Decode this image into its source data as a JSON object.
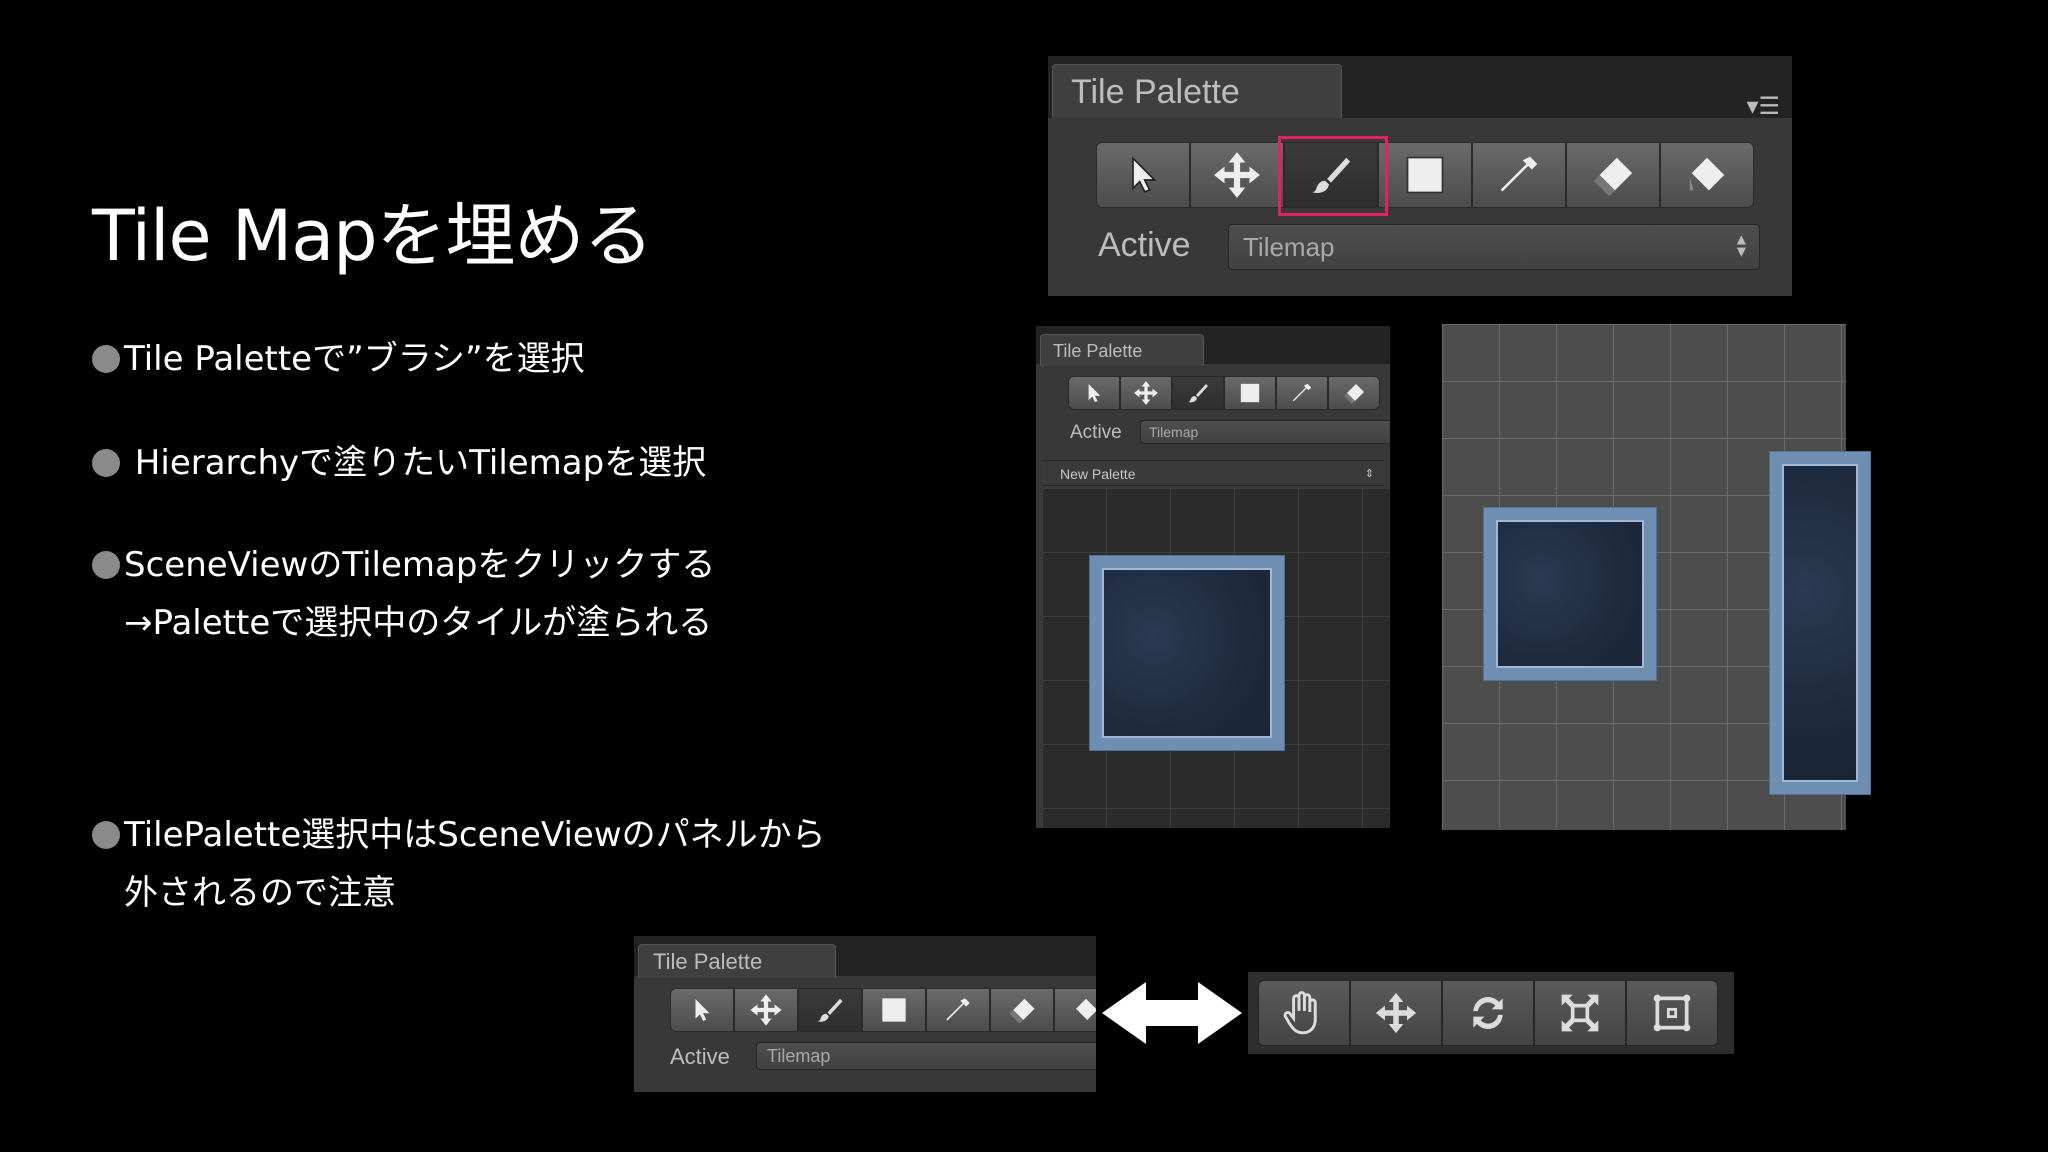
{
  "slide": {
    "title": "Tile Mapを埋める",
    "bullets": [
      {
        "line1": "Tile Paletteで”ブラシ”を選択"
      },
      {
        "line1": " Hierarchyで塗りたいTilemapを選択"
      },
      {
        "line1": "SceneViewのTilemapをクリックする",
        "line2": "→Paletteで選択中のタイルが塗られる"
      },
      {
        "line1": "TilePalette選択中はSceneViewのパネルから",
        "line2": "外されるので注意"
      }
    ]
  },
  "palette_main": {
    "tab_label": "Tile Palette",
    "active_label": "Active",
    "active_value": "Tilemap"
  },
  "palette_mid": {
    "tab_label": "Tile Palette",
    "active_label": "Active",
    "active_value": "Tilemap",
    "palette_select": "New Palette"
  },
  "palette_bottom": {
    "tab_label": "Tile Palette",
    "active_label": "Active",
    "active_value": "Tilemap"
  },
  "tools": [
    "select-icon",
    "move-icon",
    "brush-icon",
    "box-fill-icon",
    "picker-icon",
    "eraser-icon",
    "fill-icon"
  ],
  "scene_tools": [
    "hand-icon",
    "move-icon",
    "rotate-icon",
    "scale-icon",
    "rect-icon"
  ],
  "colors": {
    "highlight": "#e0245e",
    "background": "#000000",
    "bullet_dot": "#8a8a8a"
  }
}
